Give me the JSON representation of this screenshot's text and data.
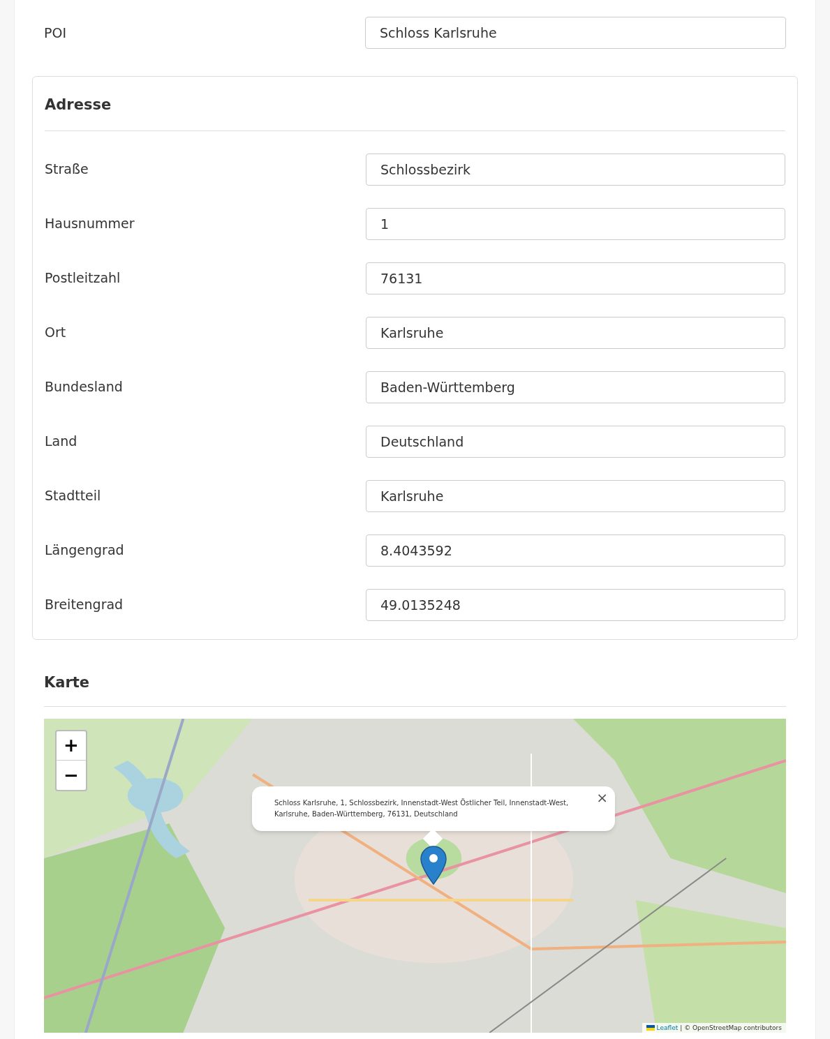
{
  "poi": {
    "label": "POI",
    "value": "Schloss Karlsruhe"
  },
  "address": {
    "title": "Adresse",
    "fields": [
      {
        "label": "Straße",
        "value": "Schlossbezirk"
      },
      {
        "label": "Hausnummer",
        "value": "1"
      },
      {
        "label": "Postleitzahl",
        "value": "76131"
      },
      {
        "label": "Ort",
        "value": "Karlsruhe"
      },
      {
        "label": "Bundesland",
        "value": "Baden-Württemberg"
      },
      {
        "label": "Land",
        "value": "Deutschland"
      },
      {
        "label": "Stadtteil",
        "value": "Karlsruhe"
      },
      {
        "label": "Längengrad",
        "value": "8.4043592"
      },
      {
        "label": "Breitengrad",
        "value": "49.0135248"
      }
    ]
  },
  "map": {
    "title": "Karte",
    "zoom_in": "+",
    "zoom_out": "−",
    "popup": {
      "text": "Schloss Karlsruhe, 1, Schlossbezirk, Innenstadt-West Östlicher Teil, Innenstadt-West, Karlsruhe, Baden-Württemberg, 76131, Deutschland",
      "close": "×"
    },
    "attribution": {
      "link": "Leaflet",
      "text": "| © OpenStreetMap contributors"
    }
  }
}
